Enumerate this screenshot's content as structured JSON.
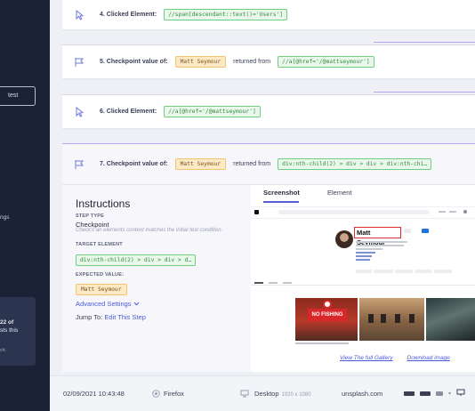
{
  "sidebar": {
    "button_label": "test",
    "item_label": "ngs",
    "card": {
      "line1": "22 of",
      "line2": "sts this",
      "line3": "ch"
    }
  },
  "steps": [
    {
      "label": "4. Clicked Element:",
      "selector": "//span[descendant::text()='Users']"
    },
    {
      "label": "5. Checkpoint value of:",
      "value": "Matt Seymour",
      "mid": "returned from",
      "selector": "//a[@href='/@mattseymour']"
    },
    {
      "label": "6. Clicked Element:",
      "selector": "//a[@href='/@mattseymour']"
    },
    {
      "label": "7. Checkpoint value of:",
      "value": "Matt Seymour",
      "mid": "returned from",
      "selector": "div:nth-child(2) > div > div > div:nth-chi…"
    }
  ],
  "instructions": {
    "title": "Instructions",
    "step_type_label": "STEP TYPE",
    "step_type_value": "Checkpoint",
    "step_type_hint": "Check's an elements content matches the initial test condition.",
    "target_label": "TARGET ELEMENT",
    "target_value": "div:nth-child(2) > div > div > d…",
    "expected_label": "EXPECTED VALUE:",
    "expected_value": "Matt Seymour",
    "advanced": "Advanced Settings",
    "jump_prefix": "Jump To:",
    "jump_link": "Edit This Step"
  },
  "preview": {
    "tabs": [
      "Screenshot",
      "Element"
    ],
    "profile_name": "Matt Seymour",
    "photo_sign": "NO FISHING",
    "view_gallery": "View The full Gallery",
    "download": "Download image"
  },
  "footer": {
    "datetime": "02/09/2021 10:43:48",
    "browser": "Firefox",
    "device": "Desktop",
    "resolution": "1920 x 1080",
    "host": "unsplash.com"
  }
}
